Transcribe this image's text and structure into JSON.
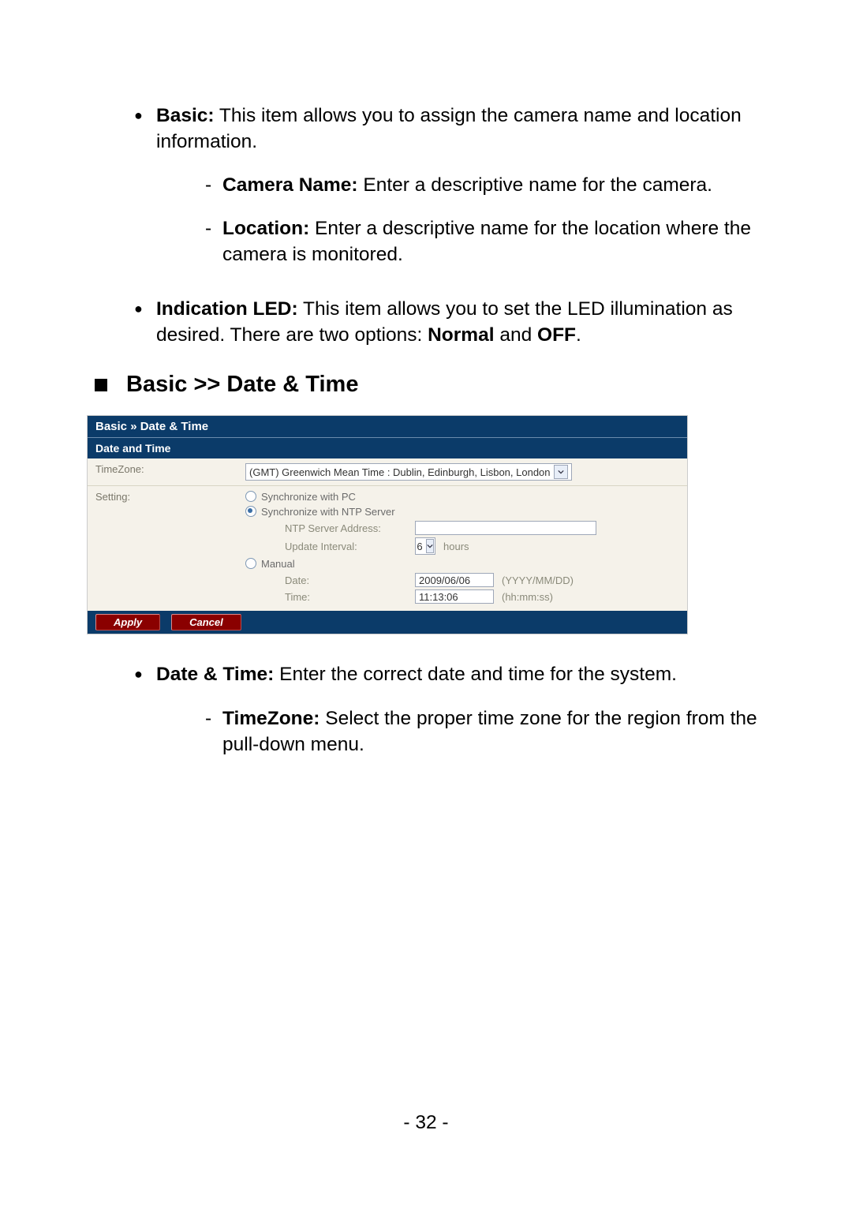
{
  "top_bullets": [
    {
      "label": "Basic:",
      "text": " This item allows you to assign the camera name and location information.",
      "subs": [
        {
          "label": "Camera Name:",
          "text": " Enter a descriptive name for the camera."
        },
        {
          "label": "Location:",
          "text": " Enter a descriptive name for the location where the camera is monitored."
        }
      ]
    },
    {
      "label": "Indication LED:",
      "text_before": " This item allows you to set the LED illumination as desired. There are two options: ",
      "bold1": "Normal",
      "mid": " and ",
      "bold2": "OFF",
      "tail": "."
    }
  ],
  "section_heading": "Basic >> Date & Time",
  "panel": {
    "title": "Basic » Date & Time",
    "subtitle": "Date and Time",
    "timezone_label": "TimeZone:",
    "timezone_value": "(GMT) Greenwich Mean Time : Dublin, Edinburgh, Lisbon, London",
    "setting_label": "Setting:",
    "opt_pc": "Synchronize with PC",
    "opt_ntp": "Synchronize with NTP Server",
    "ntp_addr_label": "NTP Server Address:",
    "ntp_addr_value": "",
    "update_label": "Update Interval:",
    "update_value": "6",
    "update_unit": "hours",
    "opt_manual": "Manual",
    "date_label": "Date:",
    "date_value": "2009/06/06",
    "date_hint": "(YYYY/MM/DD)",
    "time_label": "Time:",
    "time_value": "11:13:06",
    "time_hint": "(hh:mm:ss)",
    "apply": "Apply",
    "cancel": "Cancel",
    "selected_option": "ntp"
  },
  "lower_bullets": [
    {
      "label": "Date & Time:",
      "text": " Enter the correct date and time for the system.",
      "subs": [
        {
          "label": "TimeZone:",
          "text": " Select the proper time zone for the region from the pull-down menu."
        }
      ]
    }
  ],
  "page_number": "- 32 -"
}
